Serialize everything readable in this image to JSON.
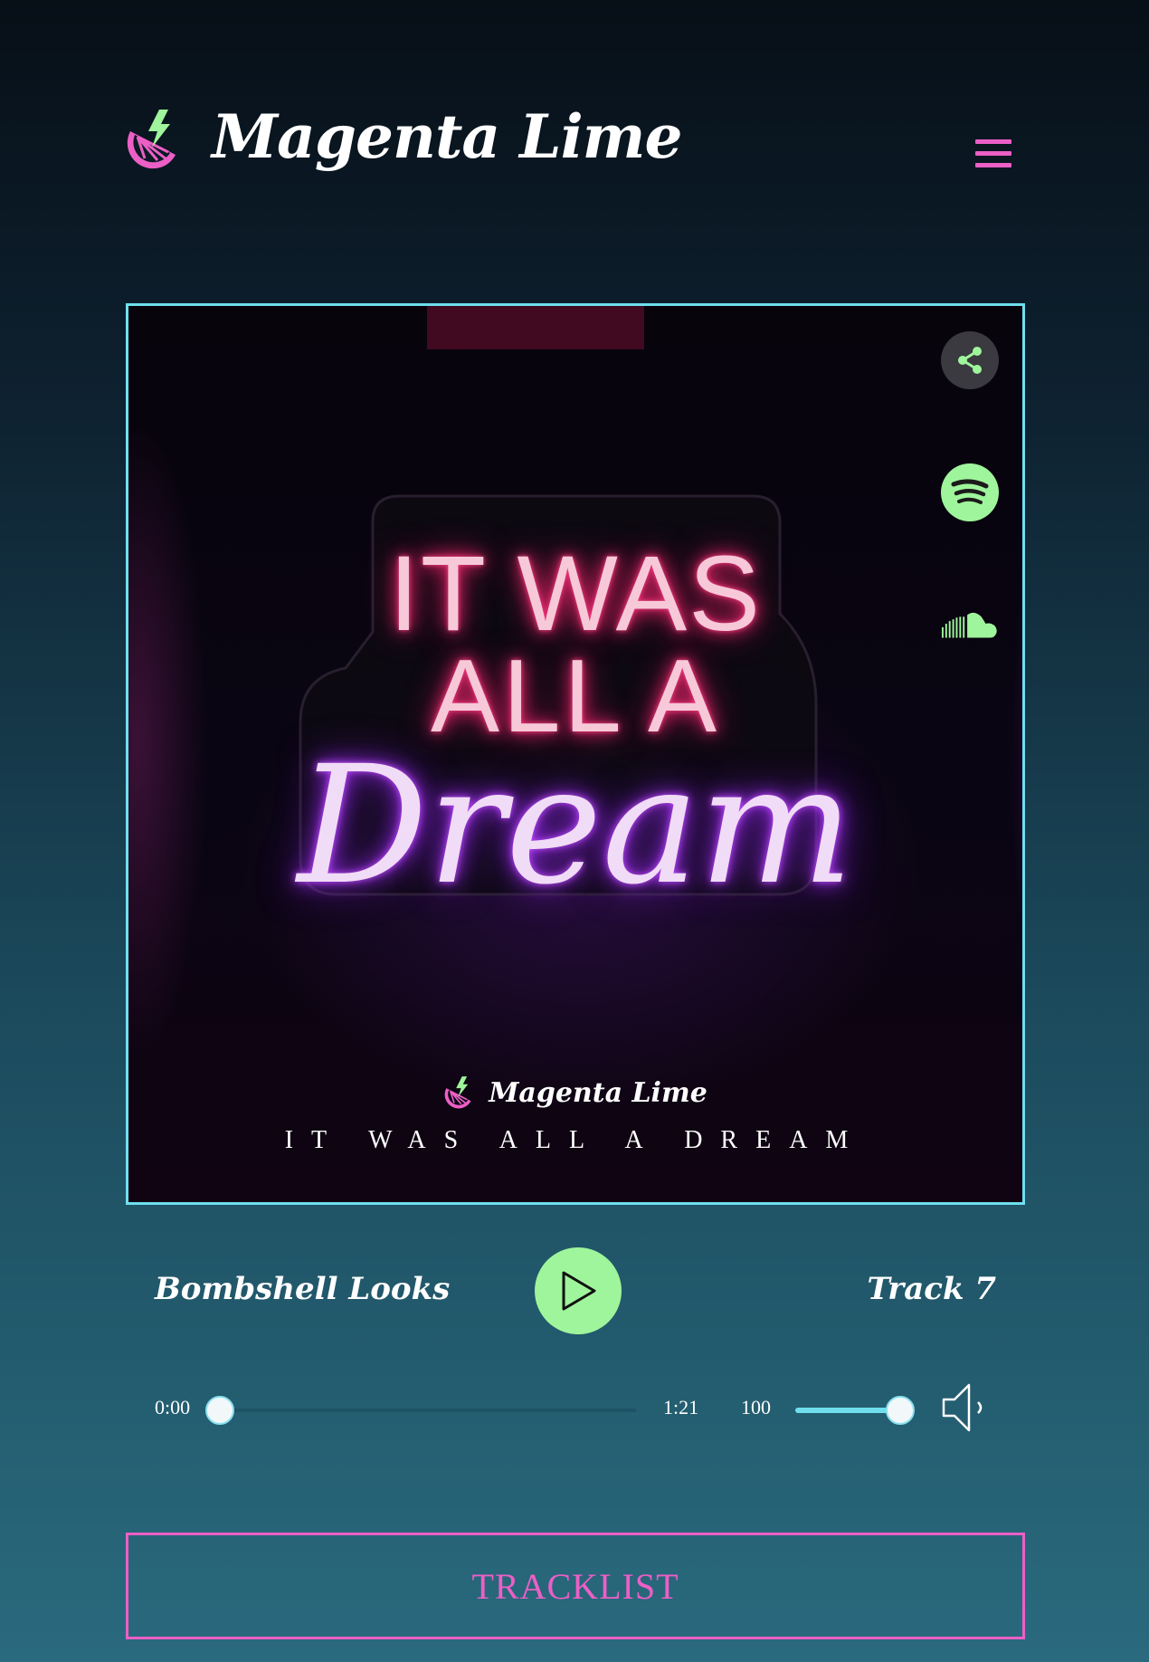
{
  "header": {
    "brand": "Magenta Lime",
    "menu_icon": "hamburger-menu-icon"
  },
  "artwork": {
    "neon_line1": "IT WAS",
    "neon_line2": "ALL A",
    "neon_script": "Dream",
    "brand": "Magenta Lime",
    "album_title": "IT WAS ALL A DREAM",
    "side_icons": [
      "share-icon",
      "spotify-icon",
      "soundcloud-icon"
    ]
  },
  "player": {
    "track_name": "Bombshell Looks",
    "track_number": "Track 7",
    "current_time": "0:00",
    "duration": "1:21",
    "seek_progress": 0,
    "volume": "100",
    "volume_level": 1.0,
    "play_icon": "play-icon",
    "speaker_icon": "speaker-icon"
  },
  "tracklist": {
    "label": "TRACKLIST"
  },
  "colors": {
    "accent_green": "#9ff59b",
    "accent_magenta": "#ec5fc6",
    "accent_cyan": "#6fdfee"
  }
}
